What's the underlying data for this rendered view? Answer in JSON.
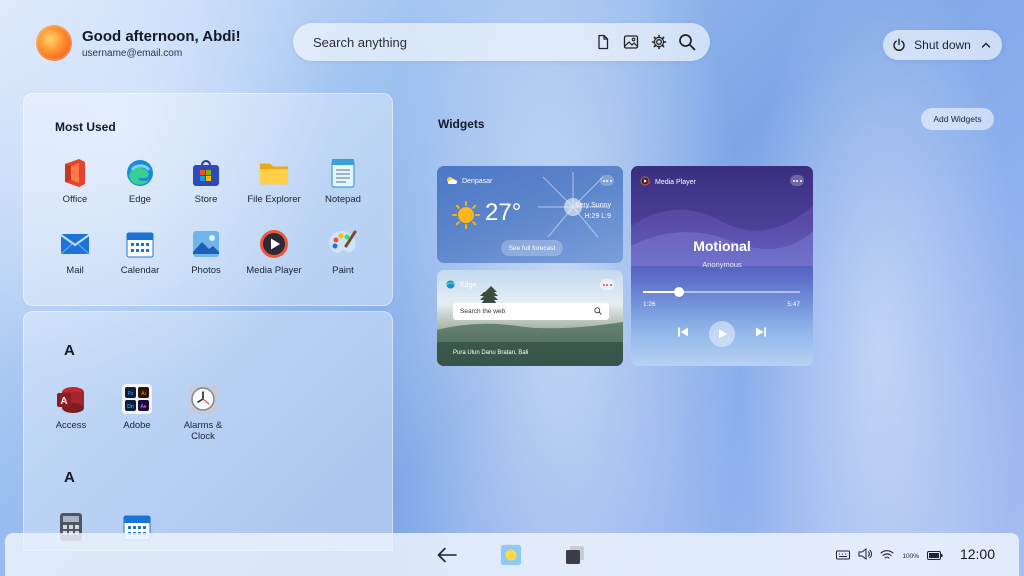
{
  "header": {
    "greeting": "Good afternoon, Abdi!",
    "email": "username@email.com",
    "search_placeholder": "Search anything",
    "shutdown_label": "Shut down"
  },
  "most_used": {
    "title": "Most Used",
    "apps": [
      {
        "label": "Office",
        "icon": "office-icon"
      },
      {
        "label": "Edge",
        "icon": "edge-icon"
      },
      {
        "label": "Store",
        "icon": "store-icon"
      },
      {
        "label": "File Explorer",
        "icon": "folder-icon"
      },
      {
        "label": "Notepad",
        "icon": "notepad-icon"
      },
      {
        "label": "Mail",
        "icon": "mail-icon"
      },
      {
        "label": "Calendar",
        "icon": "calendar-icon"
      },
      {
        "label": "Photos",
        "icon": "photos-icon"
      },
      {
        "label": "Media Player",
        "icon": "media-player-icon"
      },
      {
        "label": "Paint",
        "icon": "paint-icon"
      }
    ]
  },
  "all_apps": {
    "groups": [
      {
        "letter": "A",
        "apps": [
          {
            "label": "Access",
            "icon": "access-icon"
          },
          {
            "label": "Adobe",
            "icon": "adobe-icon"
          },
          {
            "label": "Alarms &\nClock",
            "icon": "alarm-clock-icon"
          }
        ]
      },
      {
        "letter": "A",
        "apps": [
          {
            "label": "",
            "icon": "calculator-icon"
          },
          {
            "label": "",
            "icon": "calendar-icon"
          }
        ]
      }
    ]
  },
  "widgets": {
    "title": "Widgets",
    "add_label": "Add Widgets",
    "weather": {
      "location": "Denpasar",
      "temperature": "27°",
      "condition": "Very Sunny",
      "hilo": "H:29 L:9",
      "forecast_label": "See full forecast"
    },
    "edge": {
      "name": "Edge",
      "search_placeholder": "Search the web",
      "caption": "Pura Ulun Danu Bratan, Bali"
    },
    "media": {
      "name": "Media Player",
      "song": "Motional",
      "artist": "Anonymous",
      "current_time": "1:26",
      "total_time": "5:47",
      "progress": 0.23
    }
  },
  "taskbar": {
    "battery": "100%",
    "time": "12:00"
  },
  "colors": {
    "accent": "#4a8fe0",
    "background_start": "#dfe9fb",
    "background_end": "#a7bdf0"
  }
}
